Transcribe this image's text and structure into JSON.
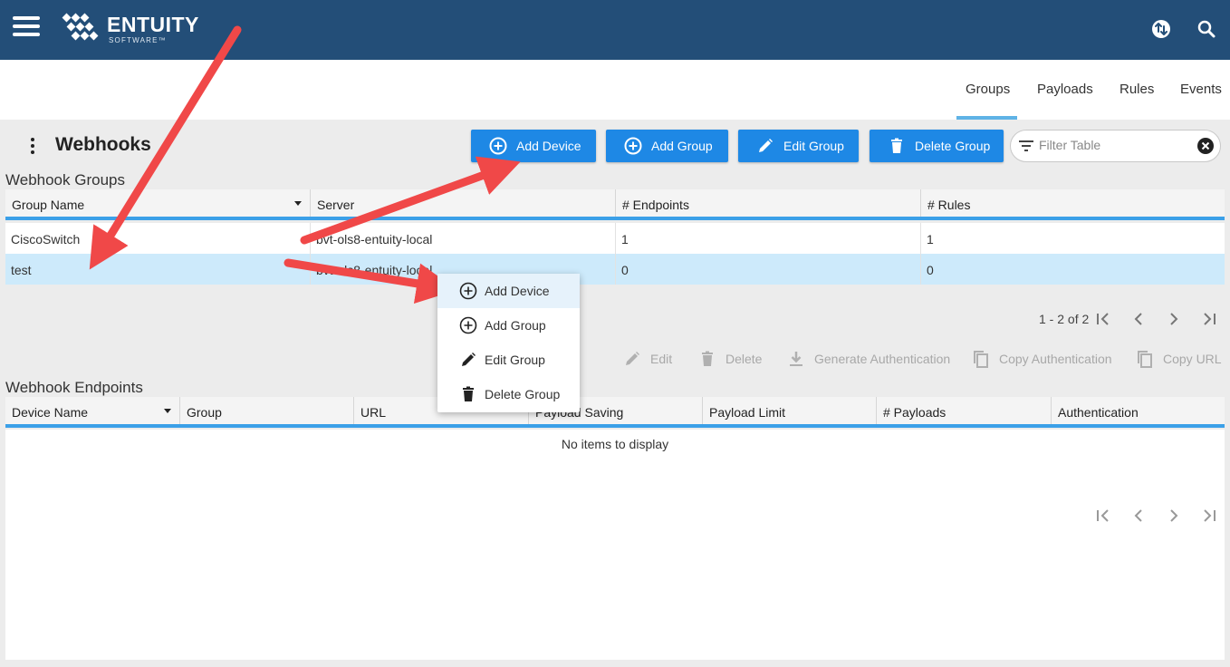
{
  "brand": {
    "name": "ENTUITY",
    "sub": "SOFTWARE™"
  },
  "nav_tabs": [
    "Groups",
    "Payloads",
    "Rules",
    "Events"
  ],
  "page": {
    "title": "Webhooks"
  },
  "toolbar": {
    "add_device": "Add Device",
    "add_group": "Add Group",
    "edit_group": "Edit Group",
    "delete_group": "Delete Group",
    "filter_placeholder": "Filter Table"
  },
  "groups_table": {
    "title": "Webhook Groups",
    "columns": [
      "Group Name",
      "Server",
      "# Endpoints",
      "# Rules"
    ],
    "rows": [
      [
        "CiscoSwitch",
        "bvt-ols8-entuity-local",
        "1",
        "1"
      ],
      [
        "test",
        "bvt-ols8-entuity-local",
        "0",
        "0"
      ]
    ],
    "pager": "1 - 2 of 2"
  },
  "endpoint_actions": [
    "Edit",
    "Delete",
    "Generate Authentication",
    "Copy Authentication",
    "Copy URL"
  ],
  "endpoints_table": {
    "title": "Webhook Endpoints",
    "columns": [
      "Device Name",
      "Group",
      "URL",
      "Payload Saving",
      "Payload Limit",
      "# Payloads",
      "Authentication"
    ],
    "empty": "No items to display"
  },
  "context_menu": [
    "Add Device",
    "Add Group",
    "Edit Group",
    "Delete Group"
  ],
  "colors": {
    "header": "#234e78",
    "primary": "#1e88e5",
    "accent": "#3ba0e8",
    "selected_row": "#cdeafb",
    "annotation": "#f04848"
  }
}
